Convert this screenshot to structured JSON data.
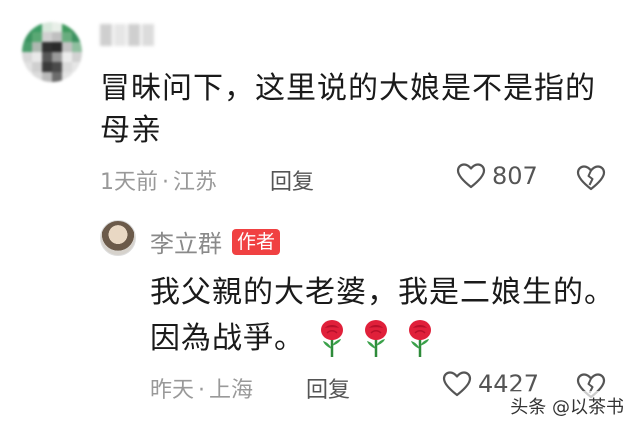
{
  "comment1": {
    "text_line1": "冒昧问下，这里说的大娘是不是指的",
    "text_line2": "母亲",
    "time": "1天前",
    "dot": "·",
    "location": "江苏",
    "reply_label": "回复",
    "likes": "807"
  },
  "reply1": {
    "author": "李立群",
    "badge": "作者",
    "text_line1": "我父親的大老婆，我是二娘生的。",
    "text_line2": "因為战爭。",
    "time": "昨天",
    "dot": "·",
    "location": "上海",
    "reply_label": "回复",
    "likes": "4427"
  },
  "watermark": "头条 @以茶书",
  "icons": {
    "like": "heart-outline-icon",
    "dislike": "broken-heart-icon",
    "rose": "rose-emoji-icon"
  },
  "colors": {
    "badge_bg": "#f04142",
    "meta_text": "#999999",
    "rose": "#e0203a"
  }
}
